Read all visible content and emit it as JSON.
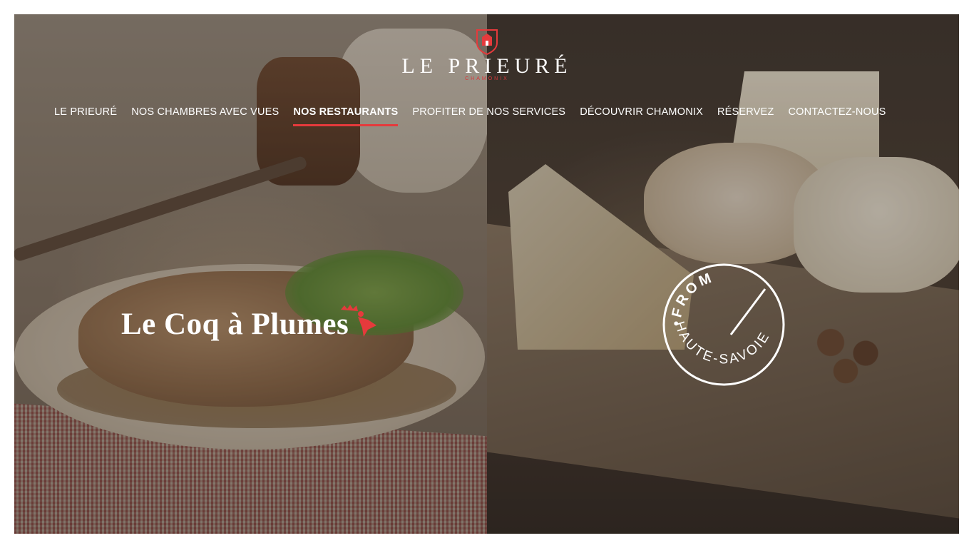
{
  "brand": {
    "name": "LE PRIEURÉ",
    "subtitle": "CHAMONIX"
  },
  "nav": {
    "items": [
      {
        "label": "LE PRIEURÉ",
        "active": false
      },
      {
        "label": "NOS CHAMBRES AVEC VUES",
        "active": false
      },
      {
        "label": "NOS RESTAURANTS",
        "active": true
      },
      {
        "label": "PROFITER DE NOS SERVICES",
        "active": false
      },
      {
        "label": "DÉCOUVRIR CHAMONIX",
        "active": false
      },
      {
        "label": "RÉSERVEZ",
        "active": false
      },
      {
        "label": "CONTACTEZ-NOUS",
        "active": false
      }
    ]
  },
  "restaurants": {
    "left": {
      "title": "Le Coq à Plumes",
      "icon": "rooster-icon"
    },
    "right": {
      "stamp_top": "•FROM",
      "stamp_bottom": "HAUTE-SAVOIE",
      "icon": "from-haute-savoie-stamp"
    }
  },
  "colors": {
    "accent": "#e53a3c",
    "text": "#ffffff"
  }
}
